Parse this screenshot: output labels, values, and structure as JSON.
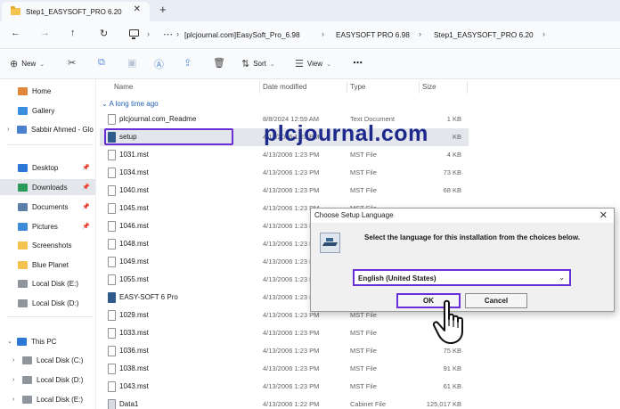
{
  "tab": {
    "title": "Step1_EASYSOFT_PRO 6.20",
    "close": "✕",
    "new": "+"
  },
  "nav": {
    "back": "←",
    "forward": "→",
    "up": "↑",
    "refresh": "↻",
    "more": "⋯",
    "breadcrumbs": [
      "[plcjournal.com]EasySoft_Pro_6.98",
      "EASYSOFT PRO 6.98",
      "Step1_EASYSOFT_PRO 6.20"
    ],
    "separator": "›"
  },
  "toolbar": {
    "new_label": "New",
    "sort_label": "Sort",
    "view_label": "View",
    "more": "⋯",
    "icons": [
      "cut-icon",
      "copy-icon",
      "paste-icon",
      "rename-icon",
      "share-icon",
      "delete-icon"
    ]
  },
  "sidebar": {
    "items": [
      {
        "label": "Home",
        "icon": "home-icon",
        "color": "#e0863a"
      },
      {
        "label": "Gallery",
        "icon": "gallery-icon",
        "color": "#3a8ee0"
      },
      {
        "label": "Sabbir Ahmed - Glo",
        "icon": "cloud-icon",
        "color": "#4b7fd1"
      },
      {
        "label": "Desktop",
        "icon": "desktop-icon",
        "color": "#2b78d6",
        "pinned": true
      },
      {
        "label": "Downloads",
        "icon": "downloads-icon",
        "color": "#2b9b5a",
        "pinned": true
      },
      {
        "label": "Documents",
        "icon": "documents-icon",
        "color": "#5b7fa8",
        "pinned": true
      },
      {
        "label": "Pictures",
        "icon": "pictures-icon",
        "color": "#3d8ad8",
        "pinned": true
      },
      {
        "label": "Screenshots",
        "icon": "folder-icon",
        "color": "#f4c34f"
      },
      {
        "label": "Blue Planet",
        "icon": "folder-icon",
        "color": "#f4c34f"
      },
      {
        "label": "Local Disk (E:)",
        "icon": "drive-icon",
        "color": "#8e959c"
      },
      {
        "label": "Local Disk (D:)",
        "icon": "drive-icon",
        "color": "#8e959c"
      },
      {
        "label": "This PC",
        "icon": "pc-icon",
        "color": "#2b78d6"
      },
      {
        "label": "Local Disk (C:)",
        "icon": "drive-icon",
        "color": "#8e959c"
      },
      {
        "label": "Local Disk (D:)",
        "icon": "drive-icon",
        "color": "#8e959c"
      },
      {
        "label": "Local Disk (E:)",
        "icon": "drive-icon",
        "color": "#8e959c"
      }
    ],
    "pin": "📌"
  },
  "columns": {
    "name": "Name",
    "date": "Date modified",
    "type": "Type",
    "size": "Size"
  },
  "group": "A long time ago",
  "files": [
    {
      "name": "plcjournal.com_Readme",
      "date": "8/8/2024 12:59 AM",
      "type": "Text Document",
      "size": "1 KB",
      "kind": "doc"
    },
    {
      "name": "setup",
      "date": "4/13/2006 1:23 PM",
      "type": "",
      "size": "KB",
      "kind": "app"
    },
    {
      "name": "1031.mst",
      "date": "4/13/2006 1:23 PM",
      "type": "MST File",
      "size": "4 KB",
      "kind": "doc"
    },
    {
      "name": "1034.mst",
      "date": "4/13/2006 1:23 PM",
      "type": "MST File",
      "size": "73 KB",
      "kind": "doc"
    },
    {
      "name": "1040.mst",
      "date": "4/13/2006 1:23 PM",
      "type": "MST File",
      "size": "68 KB",
      "kind": "doc"
    },
    {
      "name": "1045.mst",
      "date": "4/13/2006 1:23 PM",
      "type": "MST File",
      "size": "",
      "kind": "doc"
    },
    {
      "name": "1046.mst",
      "date": "4/13/2006 1:23 PM",
      "type": "",
      "size": "",
      "kind": "doc"
    },
    {
      "name": "1048.mst",
      "date": "4/13/2006 1:23 PM",
      "type": "",
      "size": "",
      "kind": "doc"
    },
    {
      "name": "1049.mst",
      "date": "4/13/2006 1:23 PM",
      "type": "",
      "size": "",
      "kind": "doc"
    },
    {
      "name": "1055.mst",
      "date": "4/13/2006 1:23 PM",
      "type": "",
      "size": "",
      "kind": "doc"
    },
    {
      "name": "EASY-SOFT 6 Pro",
      "date": "4/13/2006 1:23 PM",
      "type": "",
      "size": "",
      "kind": "app"
    },
    {
      "name": "1029.mst",
      "date": "4/13/2006 1:23 PM",
      "type": "MST File",
      "size": "",
      "kind": "doc"
    },
    {
      "name": "1033.mst",
      "date": "4/13/2006 1:23 PM",
      "type": "MST File",
      "size": "",
      "kind": "doc"
    },
    {
      "name": "1036.mst",
      "date": "4/13/2006 1:23 PM",
      "type": "MST File",
      "size": "75 KB",
      "kind": "doc"
    },
    {
      "name": "1038.mst",
      "date": "4/13/2006 1:23 PM",
      "type": "MST File",
      "size": "91 KB",
      "kind": "doc"
    },
    {
      "name": "1043.mst",
      "date": "4/13/2006 1:23 PM",
      "type": "MST File",
      "size": "61 KB",
      "kind": "doc"
    },
    {
      "name": "Data1",
      "date": "4/13/2006 1:22 PM",
      "type": "Cabinet File",
      "size": "125,017 KB",
      "kind": "cab"
    }
  ],
  "watermark": "plcjournal.com",
  "dialog": {
    "title": "Choose Setup Language",
    "close": "✕",
    "message": "Select the language for this installation from the choices below.",
    "selected_language": "English (United States)",
    "select_chevron": "⌄",
    "ok_label": "OK",
    "cancel_label": "Cancel"
  },
  "colors": {
    "highlight": "#6b2fd8",
    "watermark": "#1d2a8c",
    "group": "#1d5fb3"
  }
}
